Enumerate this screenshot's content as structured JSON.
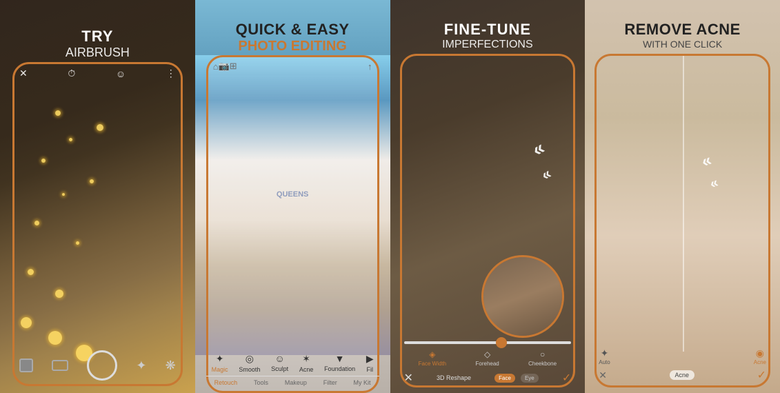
{
  "panels": [
    {
      "id": "panel-1",
      "headline_top": "TRY",
      "headline_bottom": "AIRBRUSH",
      "bg_desc": "woman laughing with sparkles",
      "bottom_icons": [
        "square",
        "rect",
        "circle",
        "tool"
      ]
    },
    {
      "id": "panel-2",
      "headline_top": "QUICK & EASY",
      "headline_color": "#c87832",
      "headline_bottom": "PHOTO EDITING",
      "bg_desc": "woman in QUEENS shirt",
      "tabs": [
        "Retouch",
        "Tools",
        "Makeup",
        "Filter",
        "My Kit"
      ],
      "tools": [
        "Magic",
        "Smooth",
        "Sculpt",
        "Acne",
        "Foundation",
        "Fil"
      ]
    },
    {
      "id": "panel-3",
      "headline_top": "FINE-TUNE",
      "headline_bottom": "IMPERFECTIONS",
      "bg_desc": "woman with glasses before/after",
      "options": [
        "3D Reshape",
        "Face",
        "Eye"
      ],
      "tools": [
        "Forehead",
        "Face Width",
        "Forehead",
        "Cheekbone"
      ]
    },
    {
      "id": "panel-4",
      "headline_top": "REMOVE ACNE",
      "headline_bottom": "WITH ONE CLICK",
      "bg_desc": "woman face before/after acne removal",
      "bottom_label": "Acne",
      "icons": [
        "Auto",
        "Acne"
      ]
    }
  ]
}
